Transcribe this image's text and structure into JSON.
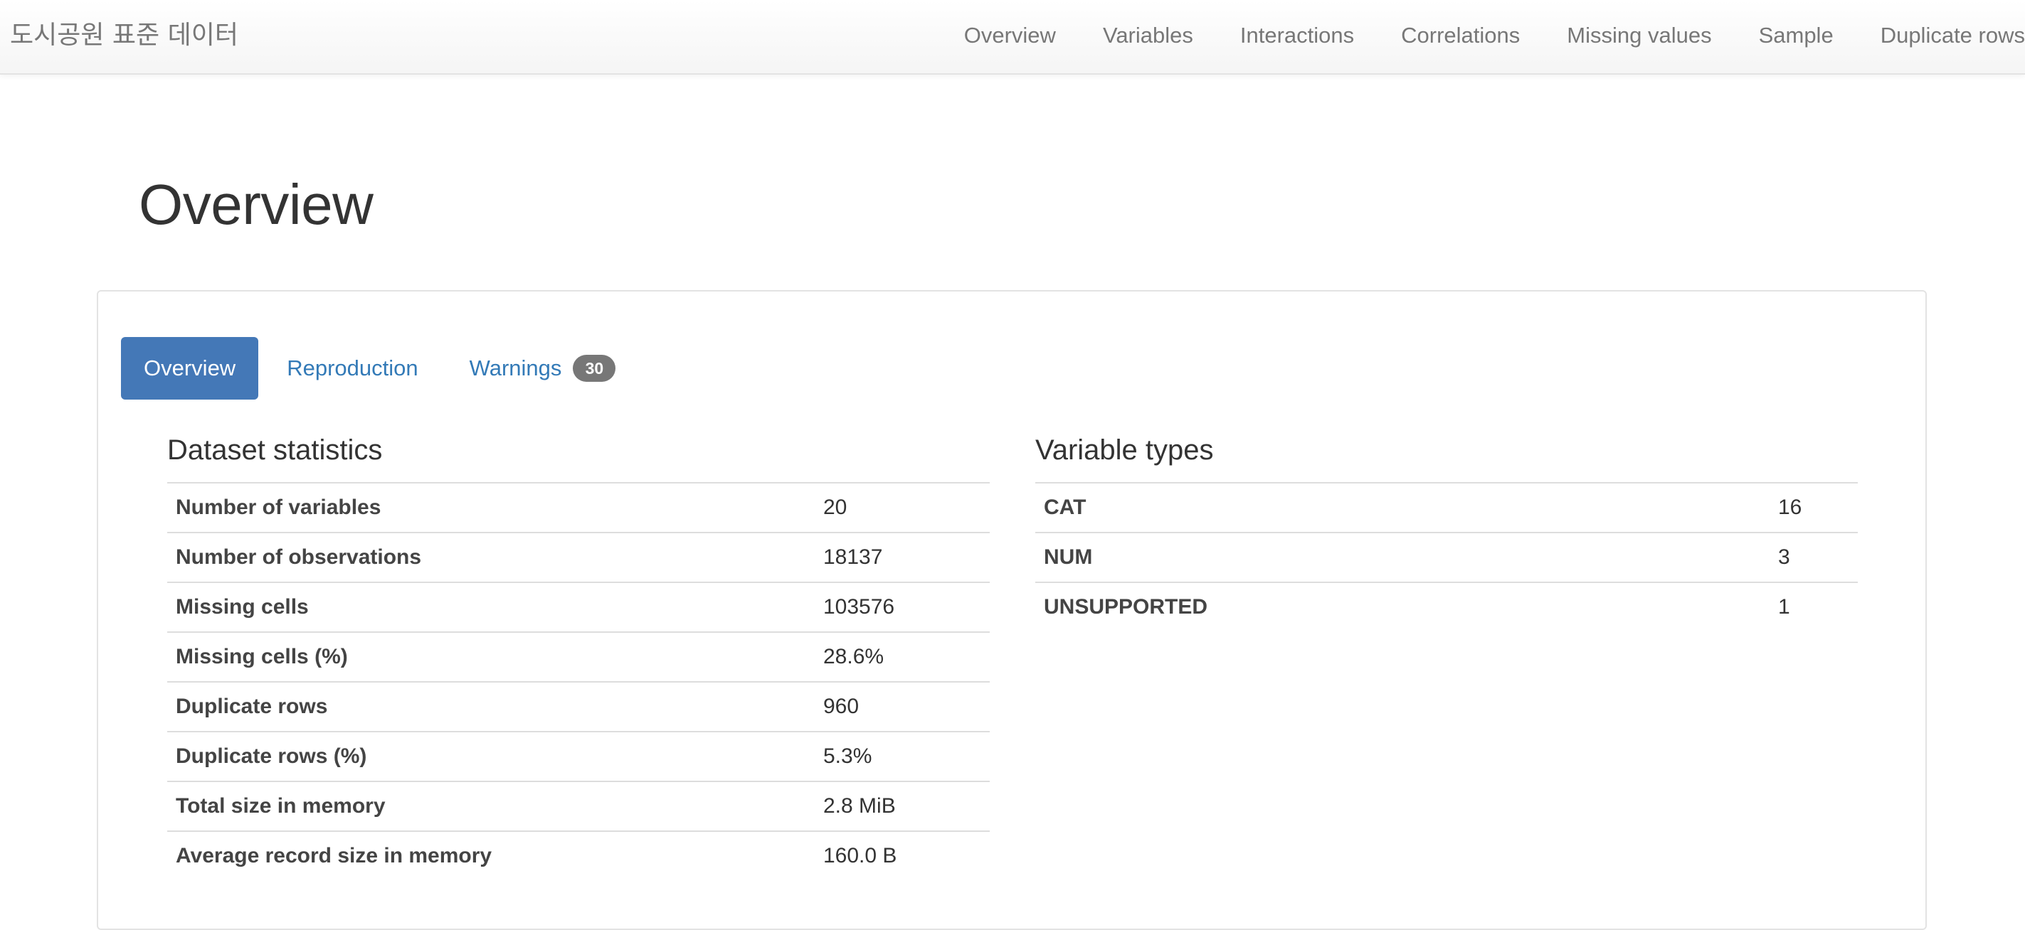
{
  "navbar": {
    "brand": "도시공원 표준 데이터",
    "links": [
      "Overview",
      "Variables",
      "Interactions",
      "Correlations",
      "Missing values",
      "Sample",
      "Duplicate rows"
    ]
  },
  "page": {
    "title": "Overview"
  },
  "tabs": {
    "overview": "Overview",
    "reproduction": "Reproduction",
    "warnings": "Warnings",
    "warnings_count": "30"
  },
  "dataset_statistics": {
    "title": "Dataset statistics",
    "rows": [
      {
        "label": "Number of variables",
        "value": "20"
      },
      {
        "label": "Number of observations",
        "value": "18137"
      },
      {
        "label": "Missing cells",
        "value": "103576"
      },
      {
        "label": "Missing cells (%)",
        "value": "28.6%"
      },
      {
        "label": "Duplicate rows",
        "value": "960"
      },
      {
        "label": "Duplicate rows (%)",
        "value": "5.3%"
      },
      {
        "label": "Total size in memory",
        "value": "2.8 MiB"
      },
      {
        "label": "Average record size in memory",
        "value": "160.0 B"
      }
    ]
  },
  "variable_types": {
    "title": "Variable types",
    "rows": [
      {
        "label": "CAT",
        "value": "16"
      },
      {
        "label": "NUM",
        "value": "3"
      },
      {
        "label": "UNSUPPORTED",
        "value": "1"
      }
    ]
  },
  "colors": {
    "accent": "#4478b7",
    "link": "#337ab7",
    "badge": "#777777"
  }
}
